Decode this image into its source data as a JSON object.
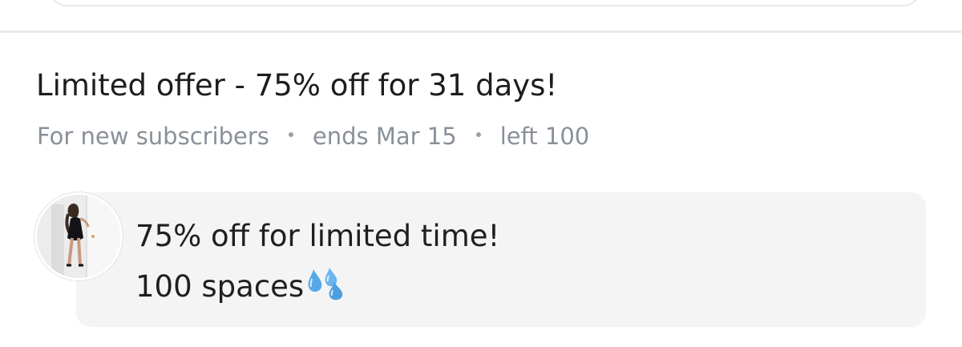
{
  "offer": {
    "title": "Limited offer - 75% off for 31 days!",
    "audience": "For new subscribers",
    "ends": "ends Mar 15",
    "left": "left 100"
  },
  "message": {
    "line1": "75% off for limited time!",
    "line2": "100 spaces",
    "line2_emoji": "sweat-droplets-icon"
  },
  "colors": {
    "title": "#1d1d1f",
    "meta": "#8a9099",
    "bubble": "#f4f4f5",
    "divider": "#e9ebee",
    "droplet": "#56a9e6"
  }
}
